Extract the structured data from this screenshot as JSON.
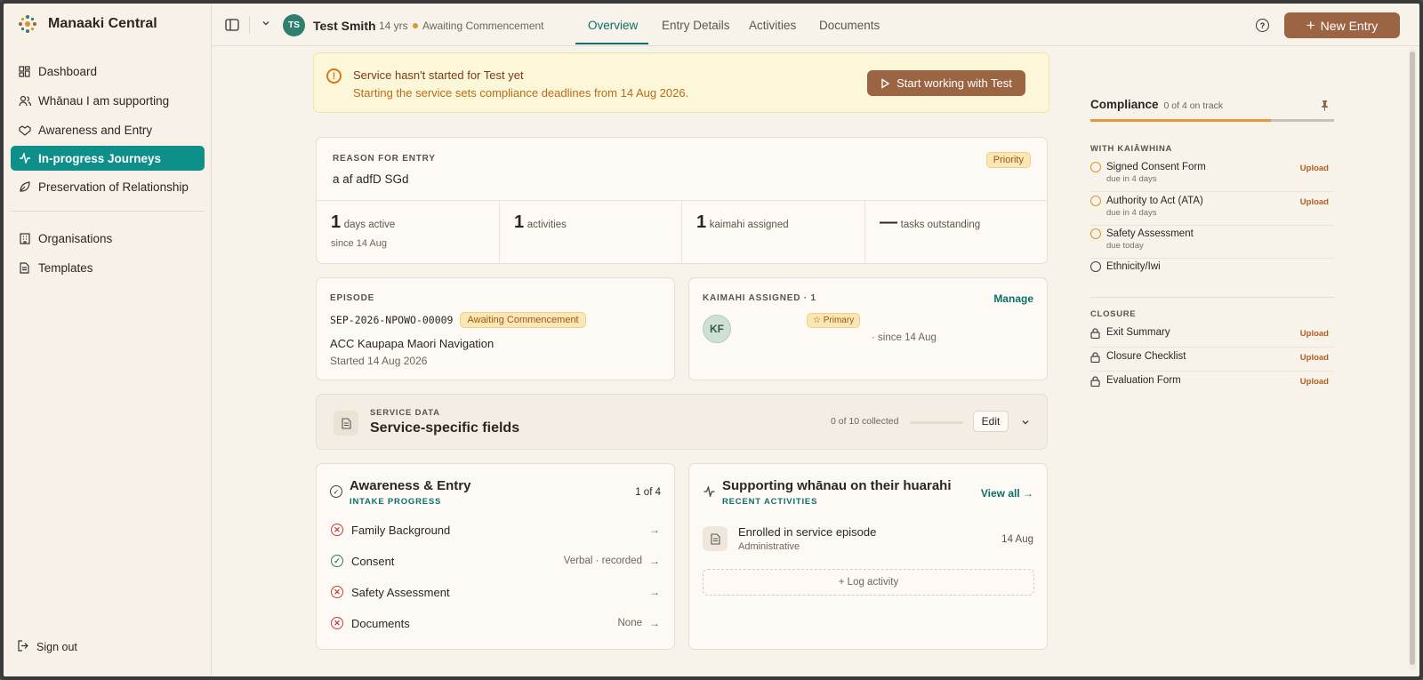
{
  "app": {
    "name": "Manaaki Central"
  },
  "sidebar": {
    "items": [
      {
        "label": "Dashboard"
      },
      {
        "label": "Whānau I am supporting"
      },
      {
        "label": "Awareness and Entry"
      },
      {
        "label": "In-progress Journeys"
      },
      {
        "label": "Preservation of Relationship"
      },
      {
        "label": "Organisations"
      },
      {
        "label": "Templates"
      }
    ],
    "sign_out": "Sign out"
  },
  "header": {
    "avatar_initials": "TS",
    "name": "Test Smith",
    "age": "14 yrs",
    "status": "Awaiting Commencement",
    "tabs": [
      "Overview",
      "Entry Details",
      "Activities",
      "Documents"
    ],
    "new_entry": "New Entry"
  },
  "banner": {
    "title": "Service hasn't started for Test yet",
    "subtitle": "Starting the service sets compliance deadlines from 14 Aug 2026.",
    "button": "Start working with Test"
  },
  "reason": {
    "label": "REASON FOR ENTRY",
    "text": "a af adfD SGd",
    "badge": "Priority",
    "stats": [
      {
        "value": "1",
        "unit": "days active",
        "since": "since 14 Aug"
      },
      {
        "value": "1",
        "unit": "activities",
        "since": ""
      },
      {
        "value": "1",
        "unit": "kaimahi assigned",
        "since": ""
      },
      {
        "value": "—",
        "unit": "tasks outstanding",
        "since": ""
      }
    ]
  },
  "episode": {
    "label": "EPISODE",
    "code": "SEP-2026-NPOWO-00009",
    "status": "Awaiting Commencement",
    "service": "ACC Kaupapa Maori Navigation",
    "started": "Started 14 Aug 2026"
  },
  "kaimahi": {
    "label": "KAIMAHI ASSIGNED · 1",
    "manage": "Manage",
    "initials": "KF",
    "role": "Primary",
    "since": "· since 14 Aug"
  },
  "service_data": {
    "label": "SERVICE DATA",
    "title": "Service-specific fields",
    "collected": "0 of 10 collected",
    "progress": 0,
    "edit": "Edit"
  },
  "intake": {
    "title": "Awareness & Entry",
    "subtitle": "INTAKE PROGRESS",
    "count": "1 of 4",
    "items": [
      {
        "label": "Family Background",
        "value": "",
        "done": false
      },
      {
        "label": "Consent",
        "value": "Verbal · recorded",
        "done": true
      },
      {
        "label": "Safety Assessment",
        "value": "",
        "done": false
      },
      {
        "label": "Documents",
        "value": "None",
        "done": false
      }
    ]
  },
  "activities": {
    "title": "Supporting whānau on their huarahi",
    "subtitle": "RECENT ACTIVITIES",
    "view_all": "View all →",
    "items": [
      {
        "title": "Enrolled in service episode",
        "type": "Administrative",
        "date": "14 Aug"
      }
    ],
    "log": "+ Log activity"
  },
  "compliance": {
    "title": "Compliance",
    "summary": "0 of 4 on track",
    "progress": 0.74,
    "sections": [
      {
        "label": "WITH KAIĀWHINA",
        "items": [
          {
            "name": "Signed Consent Form",
            "due": "due in 4 days",
            "action": "Upload"
          },
          {
            "name": "Authority to Act (ATA)",
            "due": "due in 4 days",
            "action": "Upload"
          },
          {
            "name": "Safety Assessment",
            "due": "due today",
            "action": ""
          },
          {
            "name": "Ethnicity/Iwi",
            "due": "",
            "action": ""
          }
        ]
      },
      {
        "label": "CLOSURE",
        "items": [
          {
            "name": "Exit Summary",
            "due": "",
            "action": "Upload"
          },
          {
            "name": "Closure Checklist",
            "due": "",
            "action": "Upload"
          },
          {
            "name": "Evaluation Form",
            "due": "",
            "action": "Upload"
          }
        ]
      }
    ]
  },
  "colors": {
    "accent": "#0f8f8a",
    "brand": "#9b6543",
    "warning": "#d8791c"
  }
}
